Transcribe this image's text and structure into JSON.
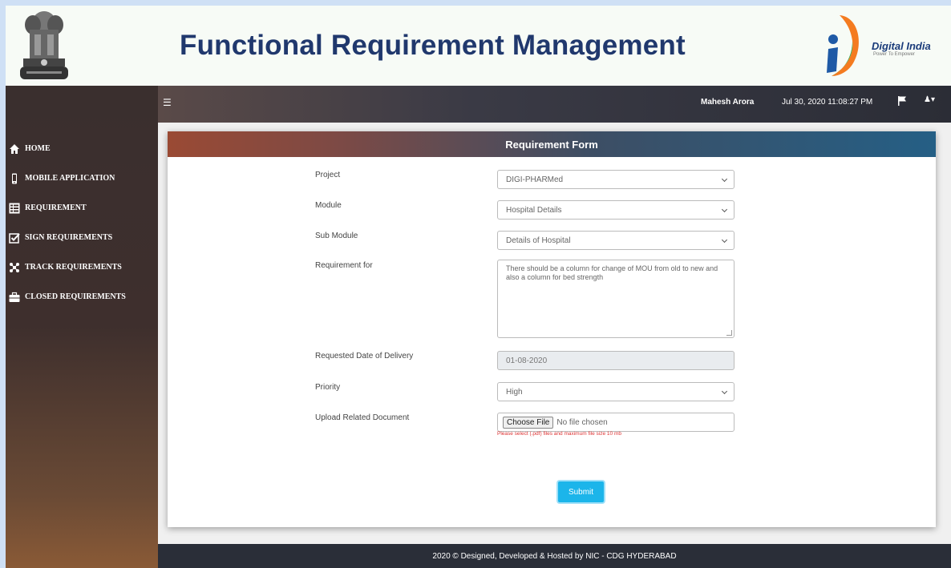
{
  "header": {
    "title": "Functional Requirement Management",
    "brand_text": "Digital India",
    "brand_tagline": "Power To Empower",
    "emblem_icon": "national-emblem-icon",
    "brand_icon": "digital-india-logo-icon"
  },
  "topbar": {
    "menu_icon": "hamburger-icon",
    "user_name": "Mahesh Arora",
    "datetime": "Jul 30, 2020 11:08:27 PM",
    "flag_icon": "flag-icon",
    "user_menu_icon": "user-dropdown-icon"
  },
  "sidebar": {
    "items": [
      {
        "label": "HOME",
        "icon": "home-icon"
      },
      {
        "label": "MOBILE APPLICATION",
        "icon": "mobile-icon"
      },
      {
        "label": "REQUIREMENT",
        "icon": "list-icon"
      },
      {
        "label": "SIGN REQUIREMENTS",
        "icon": "check-square-icon"
      },
      {
        "label": "TRACK REQUIREMENTS",
        "icon": "track-icon"
      },
      {
        "label": "CLOSED REQUIREMENTS",
        "icon": "briefcase-icon"
      }
    ]
  },
  "form": {
    "title": "Requirement Form",
    "project_label": "Project",
    "project_value": "DIGI-PHARMed",
    "module_label": "Module",
    "module_value": "Hospital Details",
    "submodule_label": "Sub Module",
    "submodule_value": "Details of Hospital",
    "requirement_label": "Requirement for",
    "requirement_value": "There should be a column for change of MOU from old to new and also a column for bed strength",
    "date_label": "Requested Date of Delivery",
    "date_value": "01-08-2020",
    "priority_label": "Priority",
    "priority_value": "High",
    "upload_label": "Upload Related Document",
    "choose_file_label": "Choose File",
    "no_file_text": "No file chosen",
    "upload_hint": "Please select (.pdf) files and maximum file size 10 mb",
    "submit_label": "Submit"
  },
  "footer": {
    "text": "2020 © Designed, Developed & Hosted by NIC - CDG HYDERABAD"
  },
  "colors": {
    "title": "#20386d",
    "accent_button": "#1cb5ea",
    "hint": "#d33333",
    "footer_bg": "#2a2e38"
  }
}
